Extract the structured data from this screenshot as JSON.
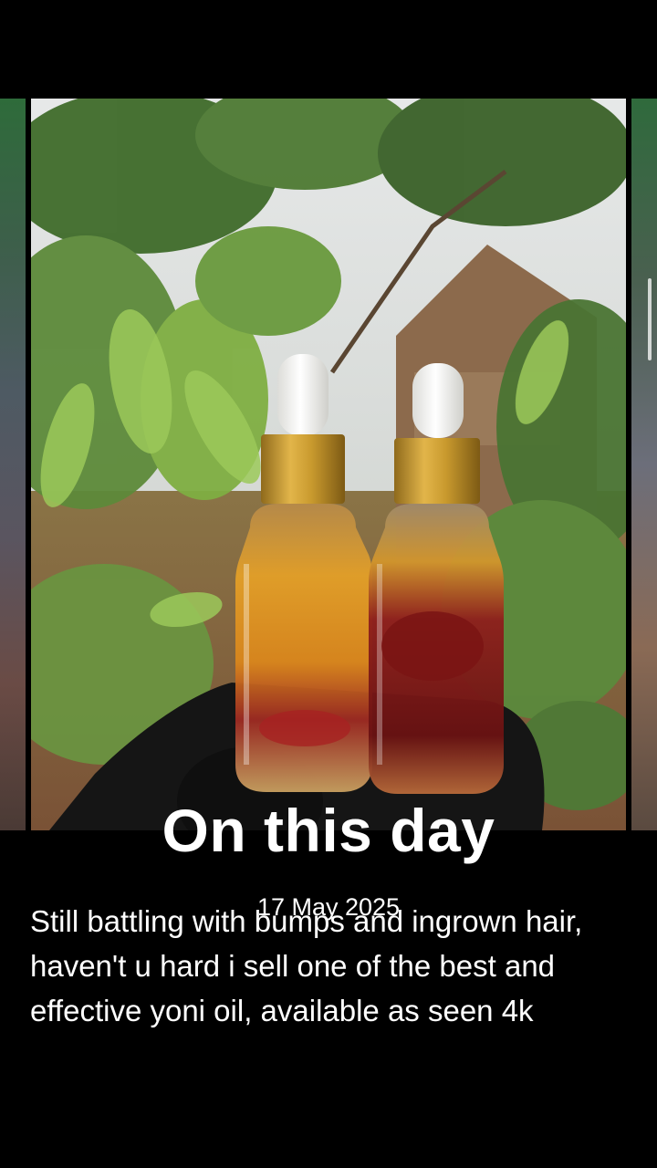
{
  "memory": {
    "title": "On this day",
    "date": "17 May 2025",
    "caption": "Still battling with bumps and ingrown hair, haven't u hard i sell one of the best and effective yoni oil, available as seen 4k"
  },
  "photo": {
    "subject": "two-dropper-bottles-with-flower-oil",
    "colors": {
      "cap": "#c9982c",
      "bulb": "#f4f4f2",
      "glove": "#141414",
      "background": "#000000",
      "text": "#ffffff"
    }
  }
}
